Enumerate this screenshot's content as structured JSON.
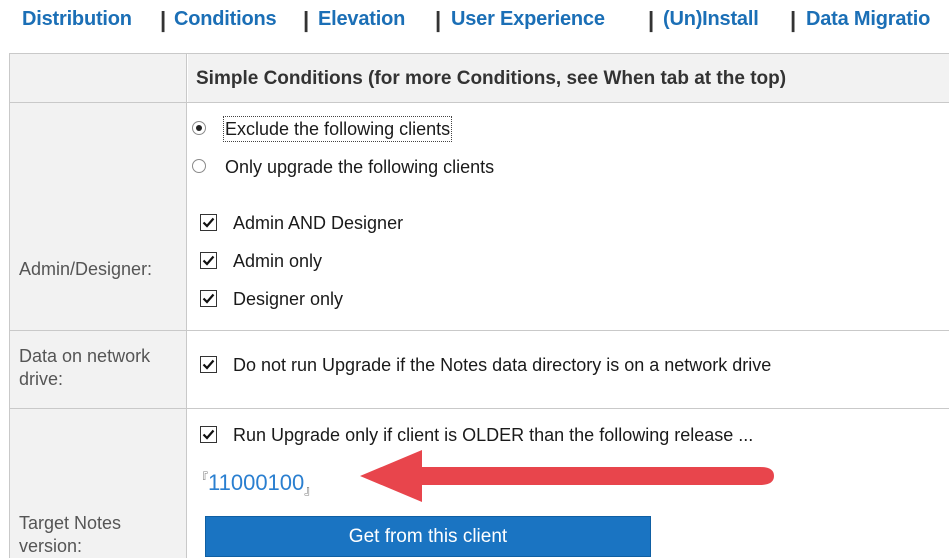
{
  "tabs": [
    {
      "label": "Distribution"
    },
    {
      "label": "Conditions"
    },
    {
      "label": "Elevation"
    },
    {
      "label": "User Experience"
    },
    {
      "label": "(Un)Install"
    },
    {
      "label": "Data Migratio"
    }
  ],
  "header": {
    "title": "Simple Conditions (for more Conditions, see When tab at the top)"
  },
  "admin_designer": {
    "label": "Admin/Designer:",
    "radio_exclude": "Exclude the following clients",
    "radio_only": "Only upgrade the following clients",
    "chk_admin_and_designer": "Admin AND Designer",
    "chk_admin_only": "Admin only",
    "chk_designer_only": "Designer only"
  },
  "network": {
    "label_line1": "Data on network",
    "label_line2": "drive:",
    "checkbox": "Do not run Upgrade if the Notes data directory is on a network drive"
  },
  "target": {
    "label_line1": "Target Notes",
    "label_line2": "version:",
    "checkbox": "Run Upgrade only if client is OLDER than the following release ...",
    "version_open": "『",
    "version_value": "11000100",
    "version_close": "』",
    "button": "Get from this client"
  },
  "colors": {
    "accent": "#1b6fb6",
    "button": "#1a74c2",
    "arrow": "#e8454c"
  }
}
